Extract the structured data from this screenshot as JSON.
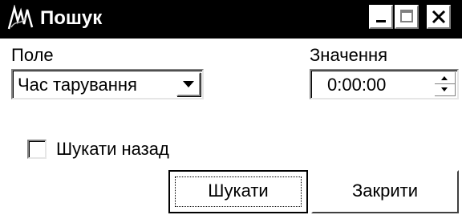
{
  "window": {
    "title": "Пошук",
    "controls": [
      "minimize-icon",
      "maximize-icon",
      "close-icon"
    ]
  },
  "field_label": "Поле",
  "field_select": {
    "value": "Час тарування"
  },
  "value_label": "Значення",
  "value_input": {
    "value": "0:00:00"
  },
  "search_backward": {
    "label": "Шукати назад",
    "checked": false
  },
  "buttons": {
    "search": "Шукати",
    "close": "Закрити"
  }
}
